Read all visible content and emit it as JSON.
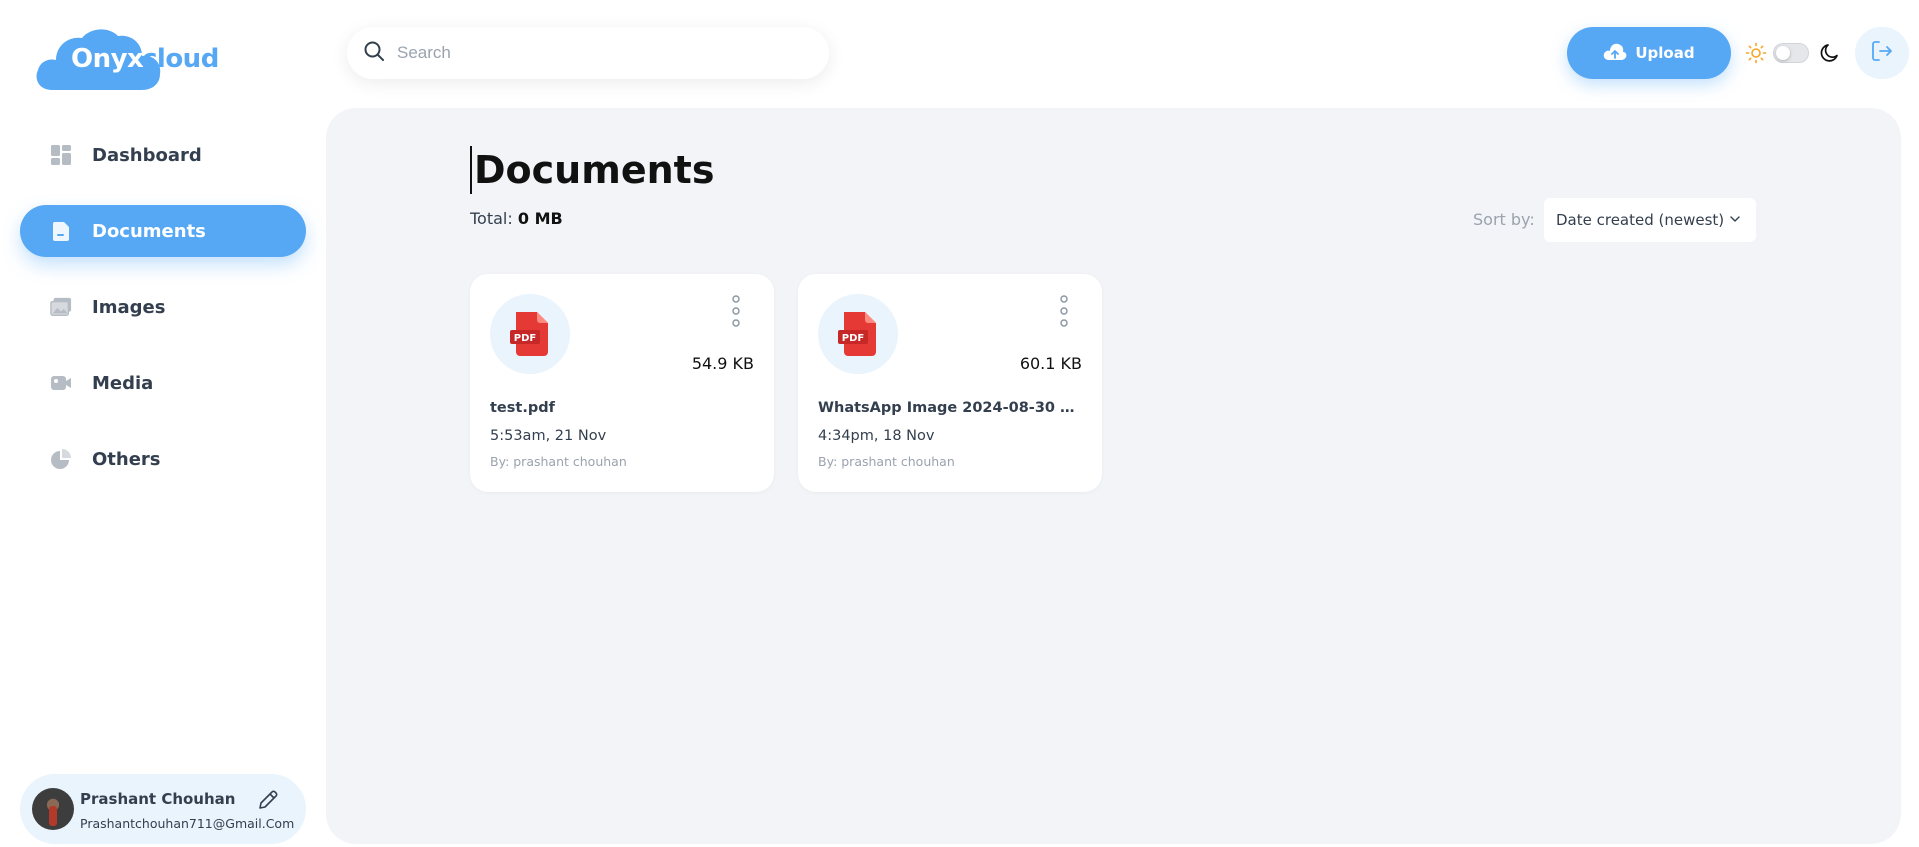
{
  "app": {
    "logo_part1": "Onyx",
    "logo_part2": "cloud"
  },
  "sidebar": {
    "items": [
      {
        "label": "Dashboard",
        "icon": "dashboard-icon",
        "active": false
      },
      {
        "label": "Documents",
        "icon": "documents-icon",
        "active": true
      },
      {
        "label": "Images",
        "icon": "images-icon",
        "active": false
      },
      {
        "label": "Media",
        "icon": "media-icon",
        "active": false
      },
      {
        "label": "Others",
        "icon": "others-icon",
        "active": false
      }
    ],
    "user": {
      "name": "Prashant Chouhan",
      "email": "Prashantchouhan711@Gmail.Com"
    }
  },
  "header": {
    "search_placeholder": "Search",
    "upload_label": "Upload"
  },
  "main": {
    "title": "Documents",
    "total_label": "Total:",
    "total_value": "0 MB",
    "sort_label": "Sort by:",
    "sort_selected": "Date created (newest)",
    "files": [
      {
        "type_badge": "PDF",
        "size": "54.9 KB",
        "name": "test.pdf",
        "date": "5:53am, 21 Nov",
        "owner": "By: prashant chouhan"
      },
      {
        "type_badge": "PDF",
        "size": "60.1 KB",
        "name": "WhatsApp Image 2024-08-30 at…",
        "date": "4:34pm, 18 Nov",
        "owner": "By: prashant chouhan"
      }
    ]
  },
  "colors": {
    "brand": "#56a8f5",
    "brand_light": "#eaf4fd",
    "pdf_red": "#e53935",
    "sun": "#f5a623",
    "main_bg": "#f2f4f8"
  }
}
